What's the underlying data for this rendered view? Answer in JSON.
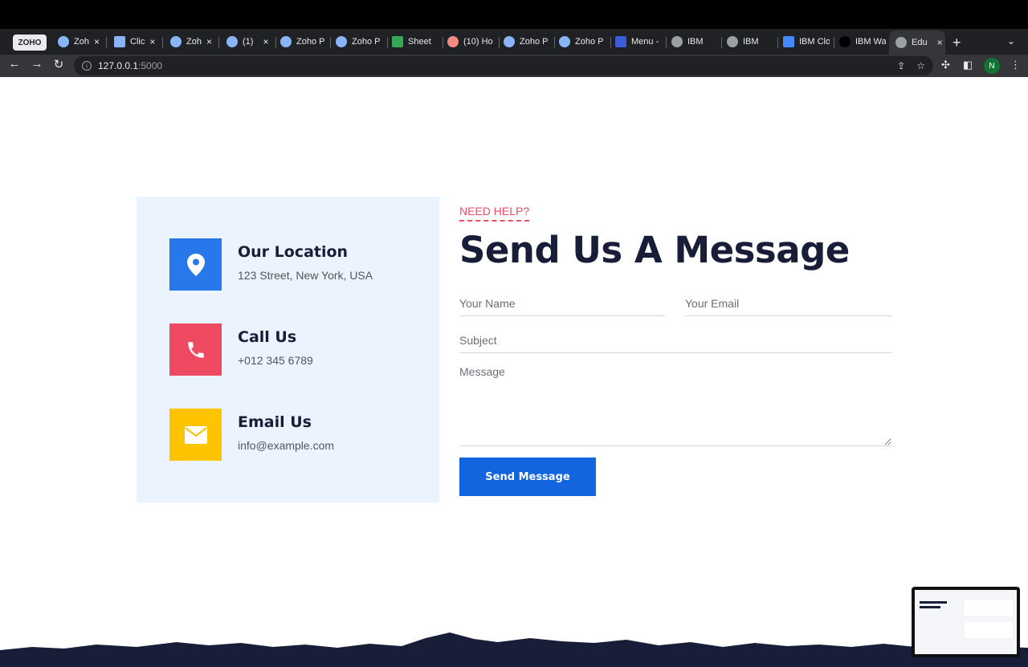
{
  "browser": {
    "tabs": [
      {
        "label": "ZOHO"
      },
      {
        "label": "Zoh"
      },
      {
        "label": "Clic"
      },
      {
        "label": "Zoh"
      },
      {
        "label": "(1)"
      },
      {
        "label": "Zoho P"
      },
      {
        "label": "Zoho P"
      },
      {
        "label": "Sheet"
      },
      {
        "label": "(10) Ho"
      },
      {
        "label": "Zoho P"
      },
      {
        "label": "Zoho P"
      },
      {
        "label": "Menu -"
      },
      {
        "label": "IBM"
      },
      {
        "label": "IBM"
      },
      {
        "label": "IBM Clo"
      },
      {
        "label": "IBM Wa"
      },
      {
        "label": "Edu"
      }
    ],
    "url_host": "127.0.0.1",
    "url_port": ":5000",
    "profile_initial": "N"
  },
  "contact_info": {
    "location": {
      "title": "Our Location",
      "value": "123 Street, New York, USA",
      "color": "#2878eb",
      "icon": "map-pin-icon"
    },
    "call": {
      "title": "Call Us",
      "value": "+012 345 6789",
      "color": "#ee4a62",
      "icon": "phone-icon"
    },
    "email": {
      "title": "Email Us",
      "value": "info@example.com",
      "color": "#ffc300",
      "icon": "envelope-icon"
    }
  },
  "form": {
    "eyebrow": "NEED HELP?",
    "heading": "Send Us A Message",
    "name_placeholder": "Your Name",
    "email_placeholder": "Your Email",
    "subject_placeholder": "Subject",
    "message_placeholder": "Message",
    "submit_label": "Send Message"
  },
  "colors": {
    "accent": "#1364df",
    "heading": "#181d38",
    "panel": "#ebf3fe"
  }
}
